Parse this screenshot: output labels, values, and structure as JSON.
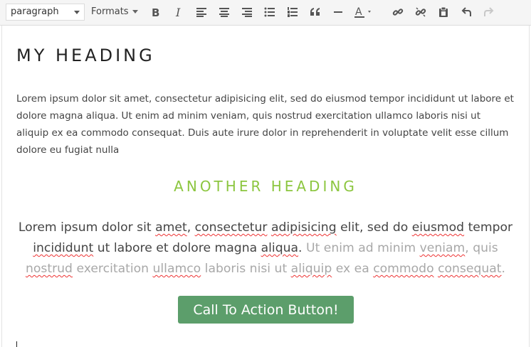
{
  "toolbar": {
    "block_format": "paragraph",
    "formats_label": "Formats",
    "buttons": [
      {
        "icon": "bold-icon"
      },
      {
        "icon": "italic-icon"
      },
      {
        "icon": "align-left-icon"
      },
      {
        "icon": "align-center-icon"
      },
      {
        "icon": "align-right-icon"
      },
      {
        "icon": "bullet-list-icon"
      },
      {
        "icon": "numbered-list-icon"
      },
      {
        "icon": "blockquote-icon"
      },
      {
        "icon": "horizontal-rule-icon"
      },
      {
        "icon": "text-color-icon"
      },
      {
        "icon": "link-icon"
      },
      {
        "icon": "unlink-icon"
      },
      {
        "icon": "paste-icon"
      },
      {
        "icon": "undo-icon"
      },
      {
        "icon": "redo-icon"
      }
    ]
  },
  "content": {
    "heading1": "MY HEADING",
    "paragraph1": "Lorem ipsum dolor sit amet, consectetur adipisicing elit, sed do eiusmod tempor incididunt ut labore et dolore magna aliqua. Ut enim ad minim veniam, quis nostrud exercitation ullamco laboris nisi ut aliquip ex ea commodo consequat. Duis aute irure dolor in reprehenderit in voluptate velit esse cillum dolore eu fugiat nulla",
    "heading2": "ANOTHER HEADING",
    "paragraph2_dark": "Lorem ipsum dolor sit amet, consectetur adipisicing elit, sed do eiusmod tempor incididunt ut labore et dolore magna aliqua.",
    "paragraph2_light": "Ut enim ad minim veniam, quis nostrud exercitation ullamco laboris nisi ut aliquip ex ea commodo consequat.",
    "cta_label": "Call To Action Button!"
  },
  "colors": {
    "heading2": "#8cc63f",
    "cta_background": "#5c9e6b",
    "spellcheck_underline": "#e33"
  }
}
